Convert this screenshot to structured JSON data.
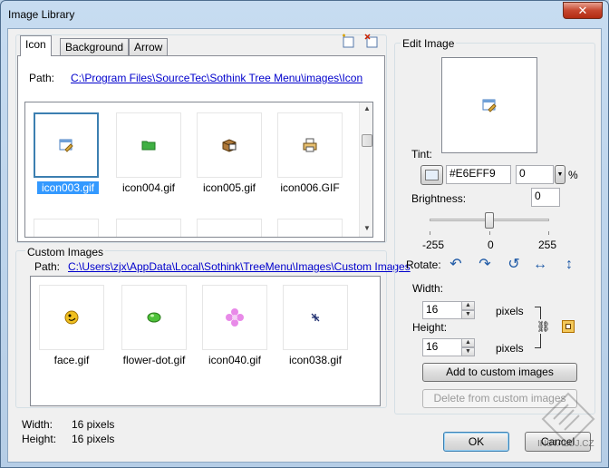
{
  "window": {
    "title": "Image Library",
    "close_glyph": "✕"
  },
  "tabs": [
    {
      "label": "Icon"
    },
    {
      "label": "Background"
    },
    {
      "label": "Arrow"
    }
  ],
  "icon_tab": {
    "path_label": "Path:",
    "path": "C:\\Program Files\\SourceTec\\Sothink Tree Menu\\images\\Icon",
    "images": [
      {
        "name": "icon003.gif",
        "icon": "edit-window-icon"
      },
      {
        "name": "icon004.gif",
        "icon": "green-folder-icon"
      },
      {
        "name": "icon005.gif",
        "icon": "package-icon"
      },
      {
        "name": "icon006.GIF",
        "icon": "printer-icon"
      }
    ],
    "selected": "icon003.gif"
  },
  "custom": {
    "group_label": "Custom Images",
    "path_label": "Path:",
    "path": "C:\\Users\\zjx\\AppData\\Local\\Sothink\\TreeMenu\\Images\\Custom Images",
    "images": [
      {
        "name": "face.gif",
        "icon": "face-icon"
      },
      {
        "name": "flower-dot.gif",
        "icon": "green-dot-icon"
      },
      {
        "name": "icon040.gif",
        "icon": "pink-flower-icon"
      },
      {
        "name": "icon038.gif",
        "icon": "arrows-icon"
      }
    ]
  },
  "info": {
    "width_label": "Width:",
    "width_value": "16 pixels",
    "height_label": "Height:",
    "height_value": "16 pixels"
  },
  "edit": {
    "group_label": "Edit Image",
    "tint_label": "Tint:",
    "tint_value": "#E6EFF9",
    "tint_percent": "0",
    "percent_sign": "%",
    "brightness_label": "Brightness:",
    "brightness_value": "0",
    "slider_min": "-255",
    "slider_mid": "0",
    "slider_max": "255",
    "brightness_level": 0,
    "rotate_label": "Rotate:",
    "width_label": "Width:",
    "width_value": "16",
    "height_label": "Height:",
    "height_value": "16",
    "pixels_label": "pixels",
    "add_button": "Add to custom images",
    "delete_button": "Delete from custom images"
  },
  "footer": {
    "ok": "OK",
    "cancel": "Cancel"
  },
  "watermark": "INSTALUJ.CZ",
  "colors": {
    "tint_swatch": "#E6EFF9",
    "selection": "#3399ff",
    "link": "#0000cc"
  }
}
